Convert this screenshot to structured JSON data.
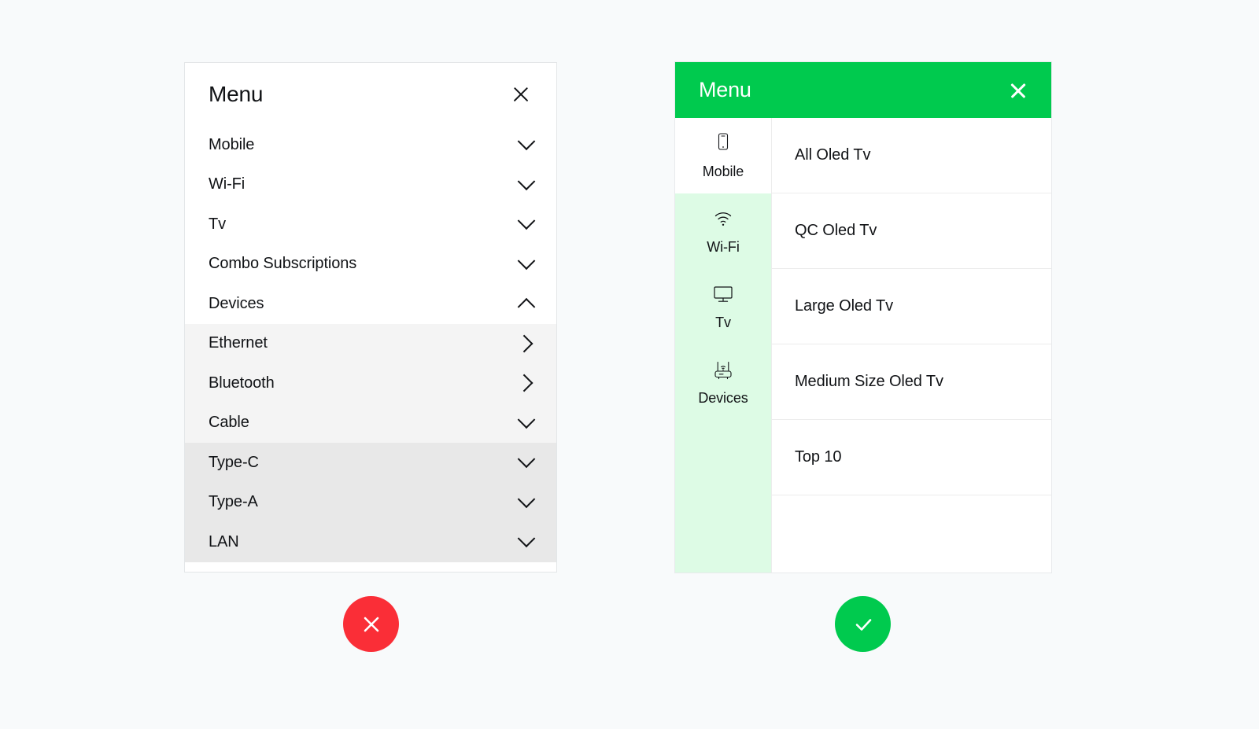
{
  "page": {
    "background_color": "#f8fafb"
  },
  "left_panel": {
    "title": "Menu",
    "close_icon": "close-icon",
    "rows": [
      {
        "label": "Mobile",
        "icon": "chevron-down-icon",
        "level": 0
      },
      {
        "label": "Wi-Fi",
        "icon": "chevron-down-icon",
        "level": 0
      },
      {
        "label": "Tv",
        "icon": "chevron-down-icon",
        "level": 0
      },
      {
        "label": "Combo Subscriptions",
        "icon": "chevron-down-icon",
        "level": 0
      },
      {
        "label": "Devices",
        "icon": "chevron-up-icon",
        "level": 0
      },
      {
        "label": "Ethernet",
        "icon": "chevron-right-icon",
        "level": 1
      },
      {
        "label": "Bluetooth",
        "icon": "chevron-right-icon",
        "level": 1
      },
      {
        "label": "Cable",
        "icon": "chevron-down-icon",
        "level": 1
      },
      {
        "label": "Type-C",
        "icon": "chevron-down-icon",
        "level": 2
      },
      {
        "label": "Type-A",
        "icon": "chevron-down-icon",
        "level": 2
      },
      {
        "label": "LAN",
        "icon": "chevron-down-icon",
        "level": 2
      }
    ]
  },
  "right_panel": {
    "title": "Menu",
    "close_icon": "close-icon",
    "header_color": "#00ca4e",
    "sidebar_tint_color": "#ddfbe5",
    "sidebar": [
      {
        "label": "Mobile",
        "icon": "mobile-phone-icon",
        "selected": false
      },
      {
        "label": "Wi-Fi",
        "icon": "wifi-icon",
        "selected": true
      },
      {
        "label": "Tv",
        "icon": "tv-monitor-icon",
        "selected": true
      },
      {
        "label": "Devices",
        "icon": "router-icon",
        "selected": true
      }
    ],
    "items": [
      {
        "label": "All Oled Tv"
      },
      {
        "label": "QC Oled Tv"
      },
      {
        "label": "Large Oled Tv"
      },
      {
        "label": "Medium Size Oled Tv"
      },
      {
        "label": "Top 10"
      }
    ]
  },
  "verdicts": {
    "bad": {
      "icon": "cross-icon",
      "color": "#fa2e37"
    },
    "good": {
      "icon": "check-icon",
      "color": "#00ca4e"
    }
  }
}
